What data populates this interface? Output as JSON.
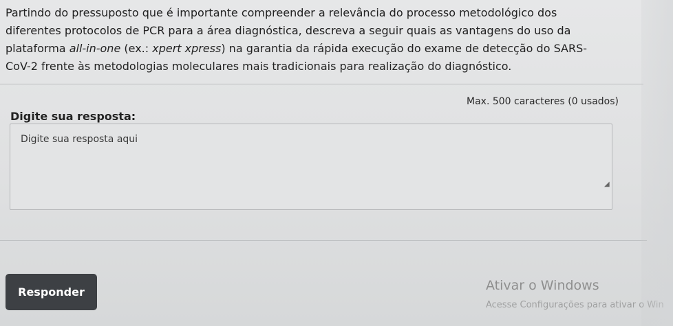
{
  "question": {
    "text_before_1": "Partindo do pressuposto que é importante compreender a relevância do processo metodológico dos diferentes protocolos de PCR para a área diagnóstica, descreva a seguir quais as vantagens do uso da plataforma ",
    "italic_1": "all-in-one",
    "text_mid": " (ex.: ",
    "italic_2": "xpert xpress",
    "text_after": ") na garantia da rápida execução do exame de detecção do SARS-CoV-2 frente às metodologias moleculares mais tradicionais para realização do diagnóstico."
  },
  "answer": {
    "label": "Digite sua resposta:",
    "char_count": "Max. 500 caracteres (0 usados)",
    "placeholder": "Digite sua resposta aqui"
  },
  "actions": {
    "submit_label": "Responder"
  },
  "watermark": {
    "title": "Ativar o Windows",
    "subtitle": "Acesse Configurações para ativar o Win"
  },
  "icons": {
    "resize_handle": "resize-grip-icon"
  }
}
